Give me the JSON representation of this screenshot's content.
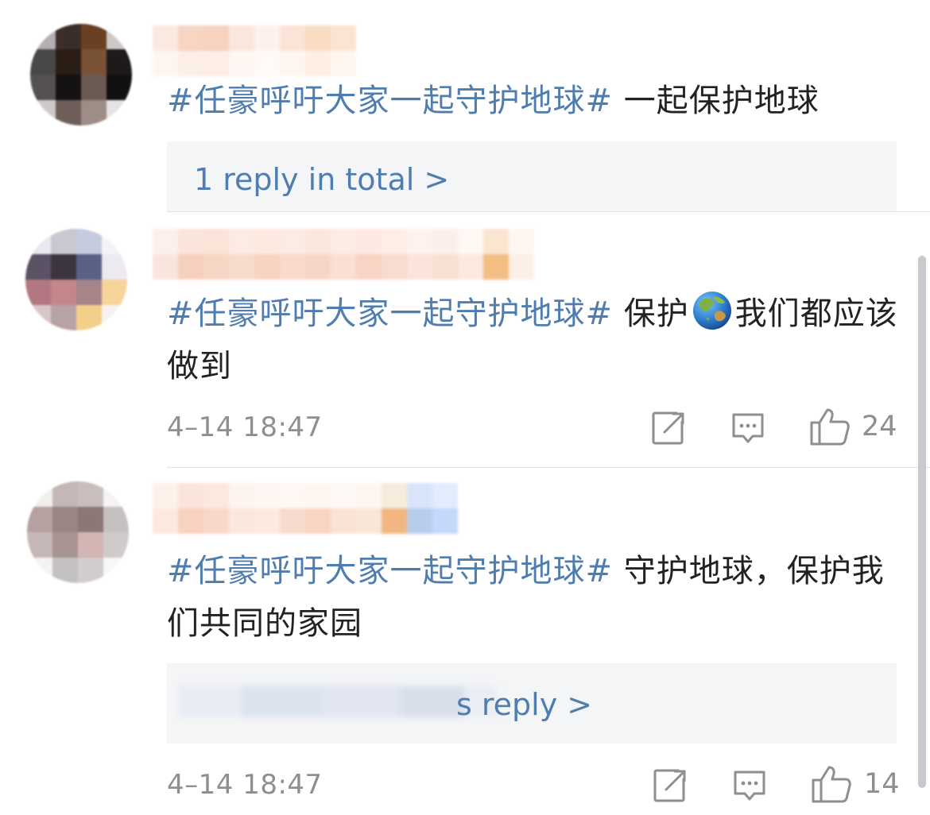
{
  "comments": [
    {
      "hashtag": "#任豪呼吁大家一起守护地球#",
      "text": " 一起保护地球",
      "reply_summary": "1 reply in total >"
    },
    {
      "hashtag": "#任豪呼吁大家一起守护地球#",
      "text_before": " 保护",
      "emoji": "globe-emoji",
      "text_after": "我们都应该做到",
      "time": "4–14 18:47",
      "likes": "24"
    },
    {
      "hashtag": "#任豪呼吁大家一起守护地球#",
      "text": " 守护地球，保护我们共同的家园",
      "reply_summary_visible": "s reply >",
      "time": "4–14 18:47",
      "likes": "14"
    }
  ],
  "colors": {
    "hashtag": "#507daf",
    "meta": "#8e8e93",
    "reply_bg": "#f4f5f7",
    "divider": "#e4e4e6"
  },
  "icons": [
    "repost-icon",
    "comment-icon",
    "like-icon",
    "globe-emoji"
  ]
}
